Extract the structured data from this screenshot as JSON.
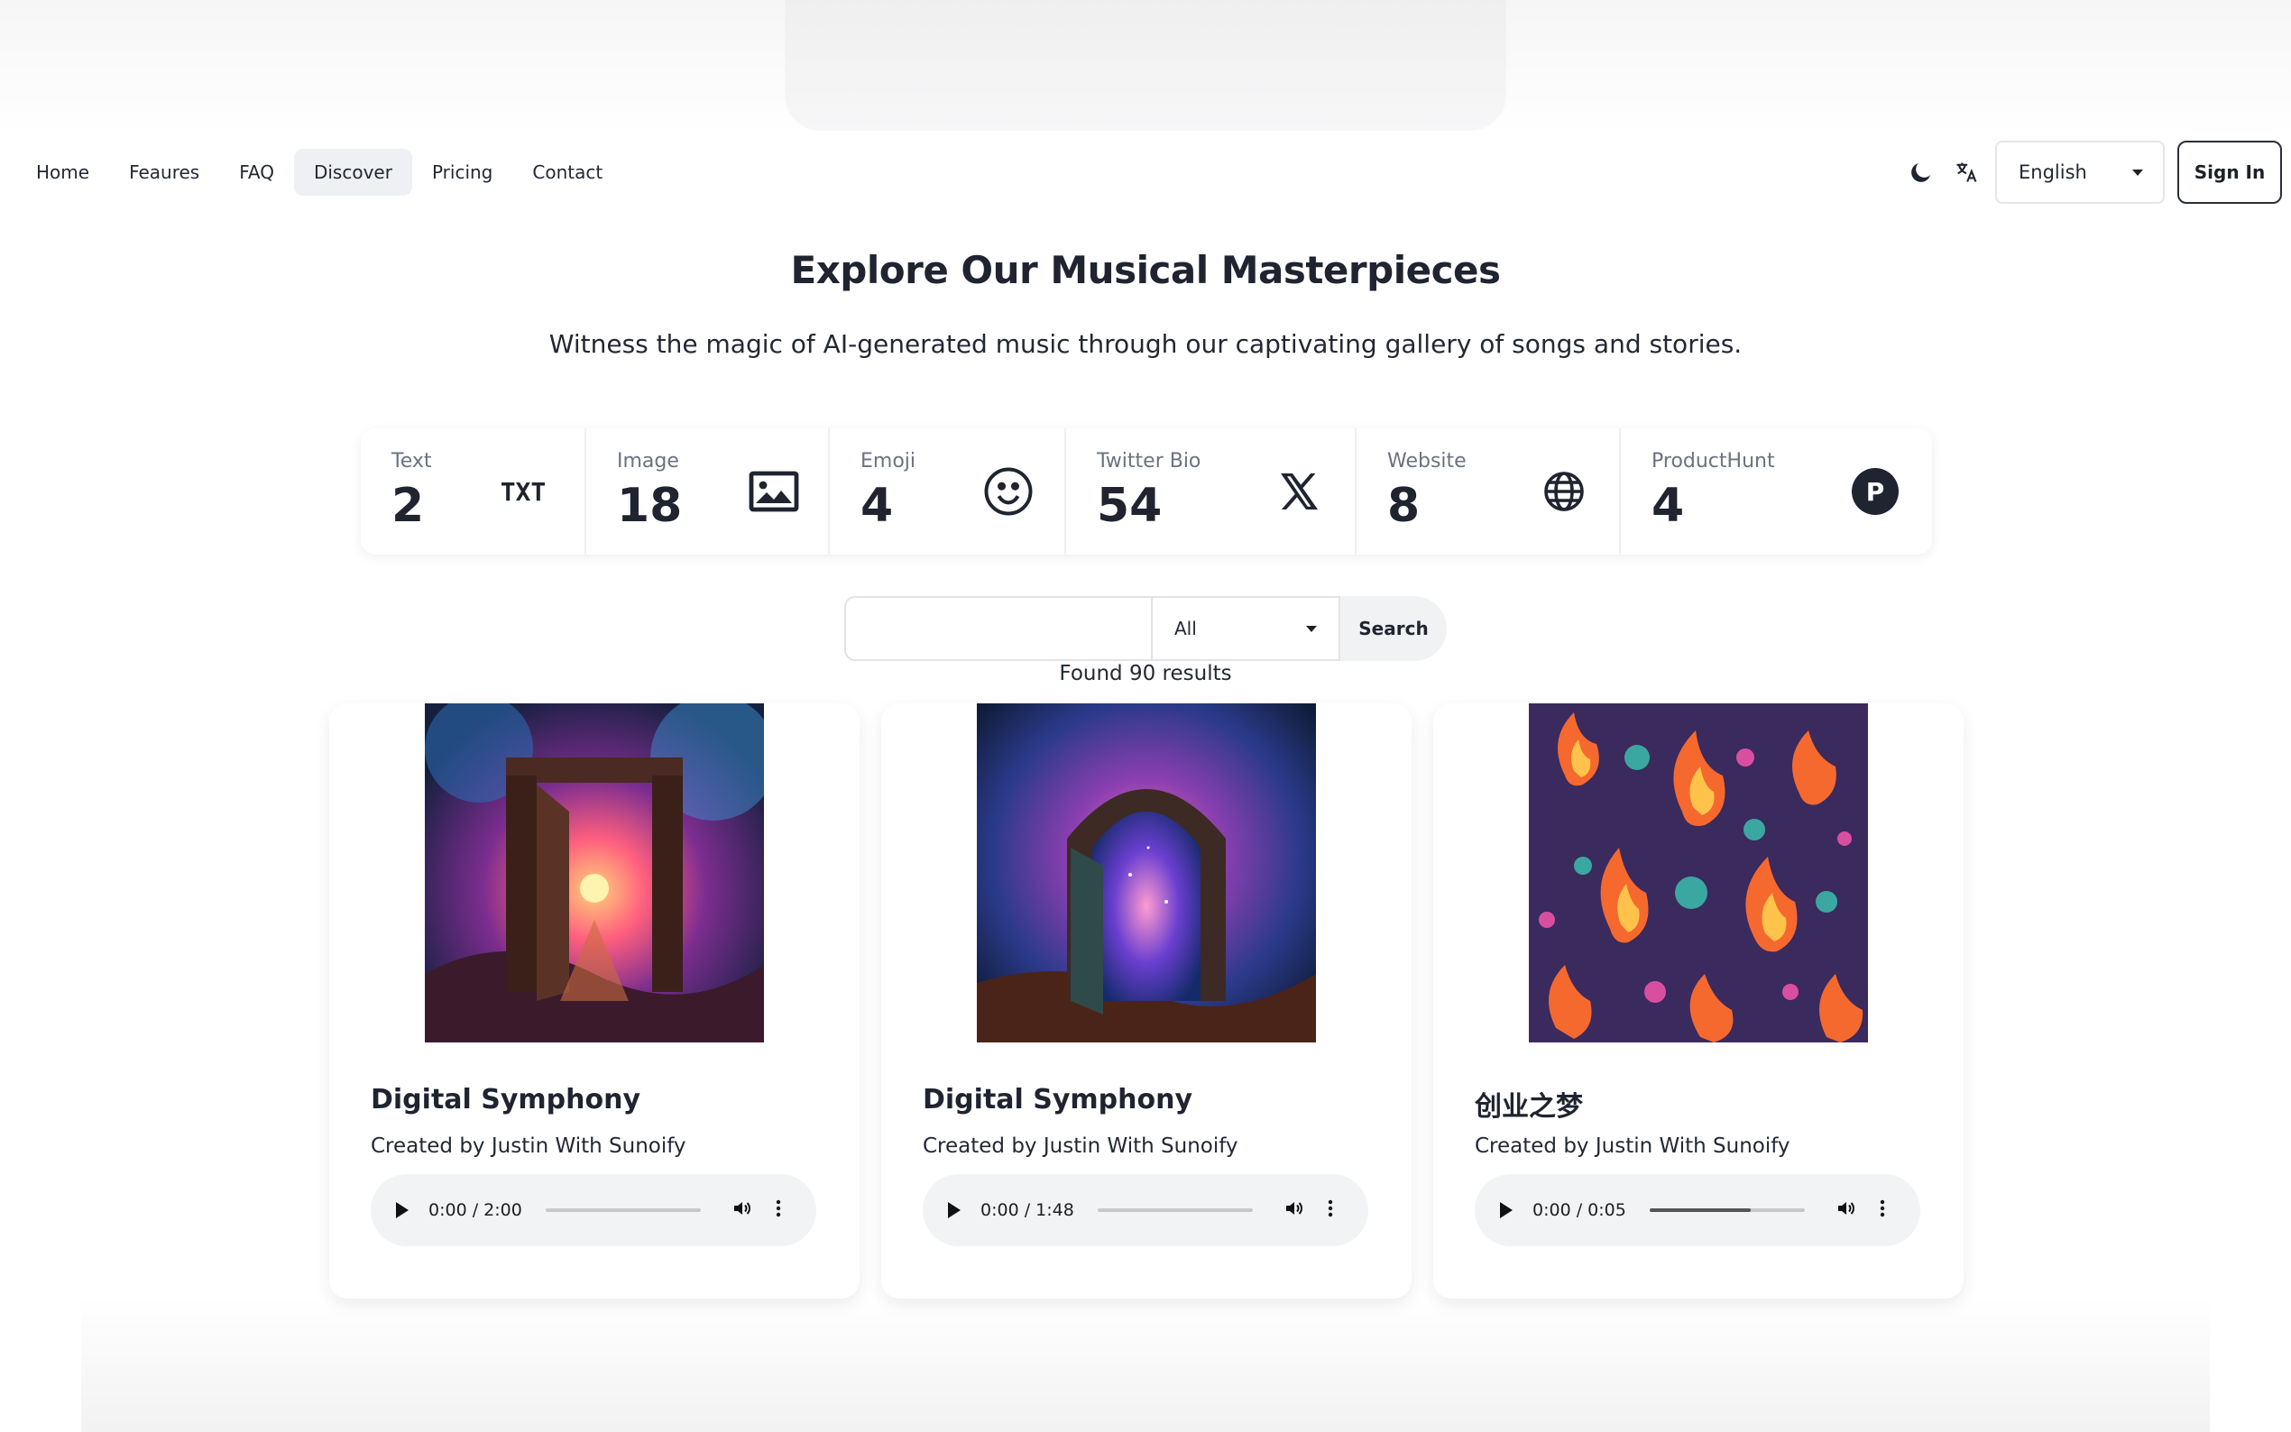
{
  "nav": {
    "links": [
      {
        "label": "Home",
        "active": false
      },
      {
        "label": "Feaures",
        "active": false
      },
      {
        "label": "FAQ",
        "active": false
      },
      {
        "label": "Discover",
        "active": true
      },
      {
        "label": "Pricing",
        "active": false
      },
      {
        "label": "Contact",
        "active": false
      }
    ],
    "language": "English",
    "signin_label": "Sign In"
  },
  "hero": {
    "title": "Explore Our Musical Masterpieces",
    "subtitle": "Witness the magic of AI-generated music through our captivating gallery of songs and stories."
  },
  "stats": [
    {
      "label": "Text",
      "value": "2",
      "icon": "txt-icon"
    },
    {
      "label": "Image",
      "value": "18",
      "icon": "image-icon"
    },
    {
      "label": "Emoji",
      "value": "4",
      "icon": "smiley-icon"
    },
    {
      "label": "Twitter Bio",
      "value": "54",
      "icon": "x-logo-icon"
    },
    {
      "label": "Website",
      "value": "8",
      "icon": "globe-icon"
    },
    {
      "label": "ProductHunt",
      "value": "4",
      "icon": "producthunt-icon"
    }
  ],
  "txt_icon_text": "TXT",
  "producthunt_letter": "P",
  "search": {
    "value": "",
    "filter": "All",
    "button_label": "Search",
    "found_text": "Found 90 results"
  },
  "cards": [
    {
      "title": "Digital Symphony",
      "by": "Created by Justin With Sunoify",
      "time": "0:00 / 2:00",
      "progress": 0.0
    },
    {
      "title": "Digital Symphony",
      "by": "Created by Justin With Sunoify",
      "time": "0:00 / 1:48",
      "progress": 0.0
    },
    {
      "title": "创业之梦",
      "by": "Created by Justin With Sunoify",
      "time": "0:00 / 0:05",
      "progress": 0.65
    }
  ],
  "colors": {
    "text": "#1f2430",
    "muted": "#6b7280",
    "active_nav_bg": "#eef0f3",
    "player_bg": "#f1f3f4"
  }
}
